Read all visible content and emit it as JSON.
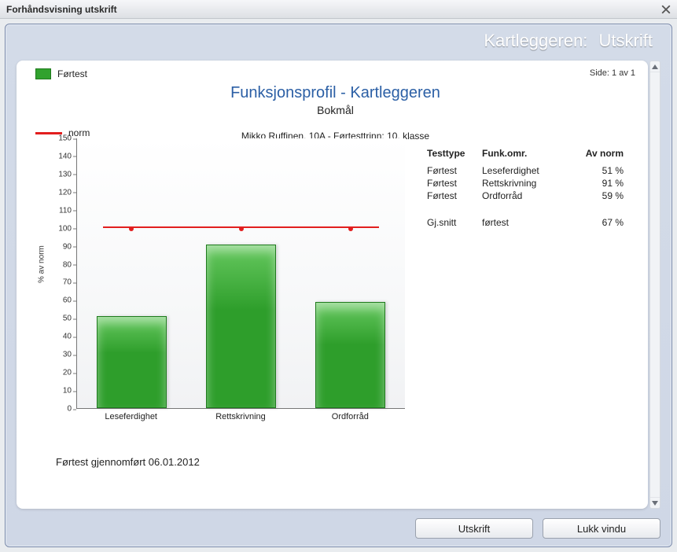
{
  "window": {
    "title": "Forhåndsvisning utskrift"
  },
  "blueHeader": {
    "label": "Kartleggeren:",
    "value": "Utskrift"
  },
  "page": {
    "label": "Side: 1 av 1"
  },
  "legend": {
    "fortest": "Førtest",
    "norm": "norm"
  },
  "doc": {
    "title": "Funksjonsprofil - Kartleggeren",
    "subtitle": "Bokmål",
    "meta": "Mikko Ruffinen, 10A - Førtesttrinn: 10. klasse"
  },
  "yAxisLabel": "% av norm",
  "sideTable": {
    "headers": {
      "c1": "Testtype",
      "c2": "Funk.omr.",
      "c3": "Av norm"
    },
    "rows": [
      {
        "c1": "Førtest",
        "c2": "Leseferdighet",
        "c3": "51 %"
      },
      {
        "c1": "Førtest",
        "c2": "Rettskrivning",
        "c3": "91 %"
      },
      {
        "c1": "Førtest",
        "c2": "Ordforråd",
        "c3": "59 %"
      }
    ],
    "avgRow": {
      "c1": "Gj.snitt",
      "c2": "førtest",
      "c3": "67 %"
    }
  },
  "footnote": "Førtest gjennomført 06.01.2012",
  "buttons": {
    "print": "Utskrift",
    "close": "Lukk vindu"
  },
  "chart_data": {
    "type": "bar",
    "categories": [
      "Leseferdighet",
      "Rettskrivning",
      "Ordforråd"
    ],
    "values": [
      51,
      91,
      59
    ],
    "normLine": 100,
    "title": "Funksjonsprofil - Kartleggeren",
    "xlabel": "",
    "ylabel": "% av norm",
    "ylim": [
      0,
      150
    ],
    "yticks": [
      0,
      10,
      20,
      30,
      40,
      50,
      60,
      70,
      80,
      90,
      100,
      110,
      120,
      130,
      140,
      150
    ]
  }
}
